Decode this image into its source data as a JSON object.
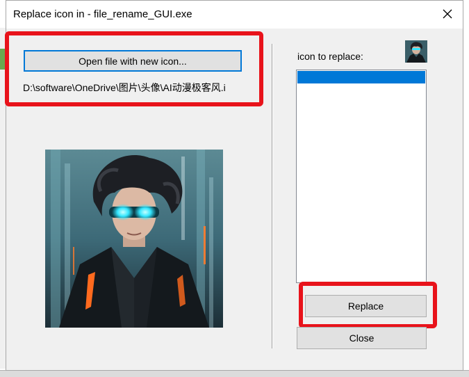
{
  "window": {
    "title": "Replace icon in - file_rename_GUI.exe",
    "close_icon": "close-icon"
  },
  "left_panel": {
    "open_button_label": "Open file with new icon...",
    "file_path": "D:\\software\\OneDrive\\图片\\头像\\AI动漫极客风.i",
    "preview_image": "anime-portrait-cyan-goggles"
  },
  "right_panel": {
    "icon_label": "icon to replace:",
    "icon_thumbnail": "anime-portrait-thumbnail",
    "list_items": [
      ""
    ],
    "replace_button_label": "Replace",
    "close_button_label": "Close"
  },
  "colors": {
    "highlight_box": "#e8131b",
    "selection": "#0078d7",
    "dialog_bg": "#f0f0f0"
  }
}
